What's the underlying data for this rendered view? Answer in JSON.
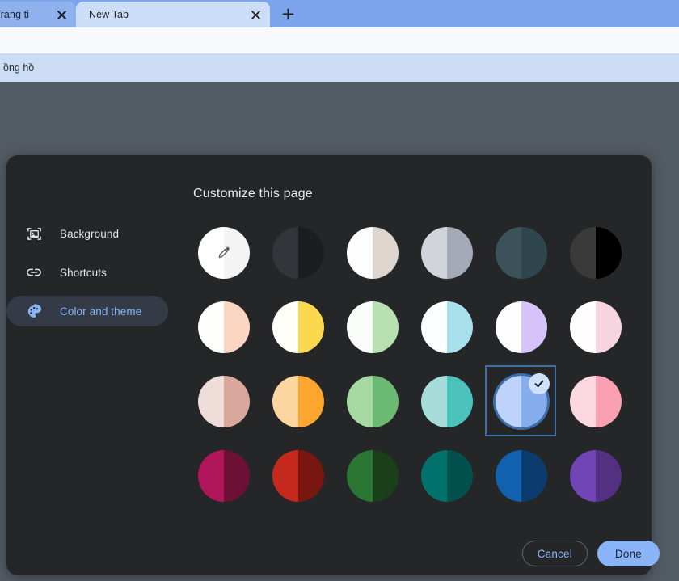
{
  "browser": {
    "tabs": [
      {
        "title": "ogle Trang ti",
        "active": false,
        "close_icon": "close-icon"
      },
      {
        "title": "New Tab",
        "active": true,
        "close_icon": "close-icon"
      }
    ],
    "new_tab_button": "+",
    "bookmarks": [
      {
        "label": "ồng hồ"
      }
    ],
    "colors": {
      "tabstrip_bg": "#7ba4ec",
      "inactive_tab_bg": "#8fb2ef",
      "active_tab_bg": "#ccddf8",
      "toolbar_bg": "#f7f9fd",
      "bookmarks_bg": "#ccdcf5",
      "page_backdrop": "#525a63"
    }
  },
  "dialog": {
    "title": "Customize this page",
    "background": "#242628",
    "sidebar": [
      {
        "label": "Background",
        "icon": "image-frame-icon",
        "selected": false
      },
      {
        "label": "Shortcuts",
        "icon": "link-chain-icon",
        "selected": false
      },
      {
        "label": "Color and theme",
        "icon": "palette-icon",
        "selected": true
      }
    ],
    "footer": {
      "cancel_label": "Cancel",
      "done_label": "Done",
      "accent": "#8ab4f8"
    },
    "selection_outline": "#3c6ea8",
    "check_icon": "check-icon",
    "eyedropper_icon": "eyedropper-icon",
    "swatches": [
      {
        "name": "custom-color-picker",
        "left": "#ffffff",
        "right": "#f4f4f5",
        "eyedropper": true,
        "selected": false
      },
      {
        "name": "dark-grey",
        "left": "#32353a",
        "right": "#1c1d20",
        "eyedropper": false,
        "selected": false
      },
      {
        "name": "warm-white",
        "left": "#fdfdfd",
        "right": "#ded5ce",
        "eyedropper": false,
        "selected": false
      },
      {
        "name": "cool-grey",
        "left": "#d1d4da",
        "right": "#a5abb6",
        "eyedropper": false,
        "selected": false
      },
      {
        "name": "slate-blue-dark",
        "left": "#3b525a",
        "right": "#2f464e",
        "eyedropper": false,
        "selected": false
      },
      {
        "name": "black",
        "left": "#3a3a3a",
        "right": "#000000",
        "eyedropper": false,
        "selected": false
      },
      {
        "name": "pastel-peach",
        "left": "#fdfdfb",
        "right": "#fad5c2",
        "eyedropper": false,
        "selected": false
      },
      {
        "name": "pastel-yellow",
        "left": "#fffef8",
        "right": "#fcd84f",
        "eyedropper": false,
        "selected": false
      },
      {
        "name": "pastel-green",
        "left": "#fbfdfa",
        "right": "#b8e0b2",
        "eyedropper": false,
        "selected": false
      },
      {
        "name": "pastel-cyan",
        "left": "#fbfefe",
        "right": "#a8e1ec",
        "eyedropper": false,
        "selected": false
      },
      {
        "name": "pastel-purple",
        "left": "#fdfcff",
        "right": "#d6c3fa",
        "eyedropper": false,
        "selected": false
      },
      {
        "name": "pastel-pink",
        "left": "#fffdfe",
        "right": "#f6d4e0",
        "eyedropper": false,
        "selected": false
      },
      {
        "name": "muted-rose",
        "left": "#eddcd7",
        "right": "#d9a79c",
        "eyedropper": false,
        "selected": false
      },
      {
        "name": "orange",
        "left": "#fcd6a0",
        "right": "#fca62f",
        "eyedropper": false,
        "selected": false
      },
      {
        "name": "green",
        "left": "#a7d9a3",
        "right": "#6bba73",
        "eyedropper": false,
        "selected": false
      },
      {
        "name": "teal",
        "left": "#a6ddd8",
        "right": "#4cc2bd",
        "eyedropper": false,
        "selected": false
      },
      {
        "name": "blue",
        "left": "#bdd3fb",
        "right": "#86aeef",
        "eyedropper": false,
        "selected": true
      },
      {
        "name": "pink",
        "left": "#fcd8e1",
        "right": "#fba0b2",
        "eyedropper": false,
        "selected": false
      },
      {
        "name": "magenta-dark",
        "left": "#b01659",
        "right": "#6e1036",
        "eyedropper": false,
        "selected": false
      },
      {
        "name": "red-dark",
        "left": "#c5281c",
        "right": "#781610",
        "eyedropper": false,
        "selected": false
      },
      {
        "name": "forest-green-dark",
        "left": "#2a7632",
        "right": "#1b3f18",
        "eyedropper": false,
        "selected": false
      },
      {
        "name": "teal-dark",
        "left": "#00716b",
        "right": "#03514f",
        "eyedropper": false,
        "selected": false
      },
      {
        "name": "blue-dark",
        "left": "#1161af",
        "right": "#0c3c6d",
        "eyedropper": false,
        "selected": false
      },
      {
        "name": "purple-dark",
        "left": "#7145b5",
        "right": "#543082",
        "eyedropper": false,
        "selected": false
      }
    ]
  }
}
